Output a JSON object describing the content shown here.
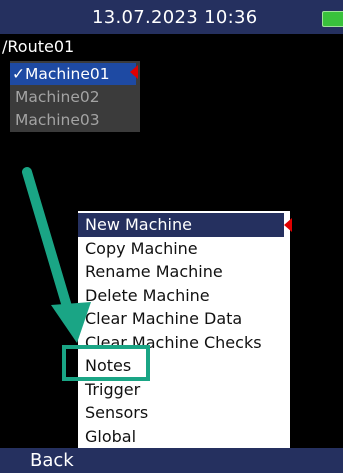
{
  "status_bar": {
    "datetime": "13.07.2023 10:36",
    "battery_icon": "battery-icon",
    "battery_color": "#39c23c"
  },
  "breadcrumb": {
    "path": "/Route01"
  },
  "machine_list": {
    "items": [
      {
        "label": "✓Machine01",
        "selected": true
      },
      {
        "label": "Machine02",
        "selected": false
      },
      {
        "label": "Machine03",
        "selected": false
      }
    ],
    "marker_icon": "selection-marker-icon"
  },
  "context_menu": {
    "items": [
      {
        "label": "New Machine",
        "highlighted": true
      },
      {
        "label": "Copy Machine"
      },
      {
        "label": "Rename Machine"
      },
      {
        "label": "Delete Machine"
      },
      {
        "label": "Clear Machine Data"
      },
      {
        "label": "Clear Machine Checks"
      },
      {
        "label": "Notes",
        "annotated": true
      },
      {
        "label": "Trigger"
      },
      {
        "label": "Sensors"
      },
      {
        "label": "Global"
      }
    ],
    "marker_icon": "menu-marker-icon"
  },
  "footer": {
    "back_label": "Back"
  },
  "annotation": {
    "arrow_icon": "pointer-arrow-icon",
    "color": "#1aa585"
  },
  "colors": {
    "bar_background": "#25305f",
    "selection_blue": "#1e4aa3",
    "marker_red": "#e00000",
    "screen_background": "#000000"
  }
}
